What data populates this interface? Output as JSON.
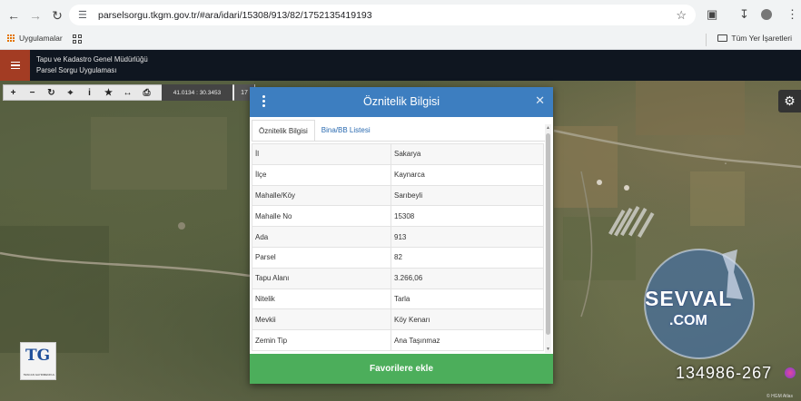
{
  "browser": {
    "url": "parselsorgu.tkgm.gov.tr/#ara/idari/15308/913/82/1752135419193",
    "bookmarks_apps_label": "Uygulamalar",
    "all_bookmarks_label": "Tüm Yer İşaretleri"
  },
  "app": {
    "title_line1": "Tapu ve Kadastro Genel Müdürlüğü",
    "title_line2": "Parsel Sorgu Uygulaması"
  },
  "toolbar": {
    "coordinates": "41.0134 : 30.3453",
    "zoom": "17"
  },
  "dialog": {
    "title": "Öznitelik Bilgisi",
    "tabs": [
      {
        "label": "Öznitelik Bilgisi",
        "active": true
      },
      {
        "label": "Bina/BB Listesi",
        "active": false
      }
    ],
    "rows": [
      {
        "key": "İl",
        "value": "Sakarya"
      },
      {
        "key": "İlçe",
        "value": "Kaynarca"
      },
      {
        "key": "Mahalle/Köy",
        "value": "Sarıbeyli"
      },
      {
        "key": "Mahalle No",
        "value": "15308"
      },
      {
        "key": "Ada",
        "value": "913"
      },
      {
        "key": "Parsel",
        "value": "82"
      },
      {
        "key": "Tapu Alanı",
        "value": "3.266,06"
      },
      {
        "key": "Nitelik",
        "value": "Tarla"
      },
      {
        "key": "Mevkii",
        "value": "Köy Kenarı"
      },
      {
        "key": "Zemin Tip",
        "value": "Ana Taşınmaz"
      }
    ],
    "favorite_button": "Favorilere ekle"
  },
  "watermark": {
    "brand_name": "SEVVAL",
    "brand_domain": ".COM",
    "listing_number": "134986-267",
    "attribution": "© HGM Atlas"
  },
  "logo": {
    "letters": "TG",
    "subtitle": "TESCAN GAYRIMENKUL"
  },
  "colors": {
    "dialog_header": "#3d7ec0",
    "favorite_button": "#4cae5b",
    "app_header": "#0f1620",
    "menu_button": "#a33c23"
  }
}
